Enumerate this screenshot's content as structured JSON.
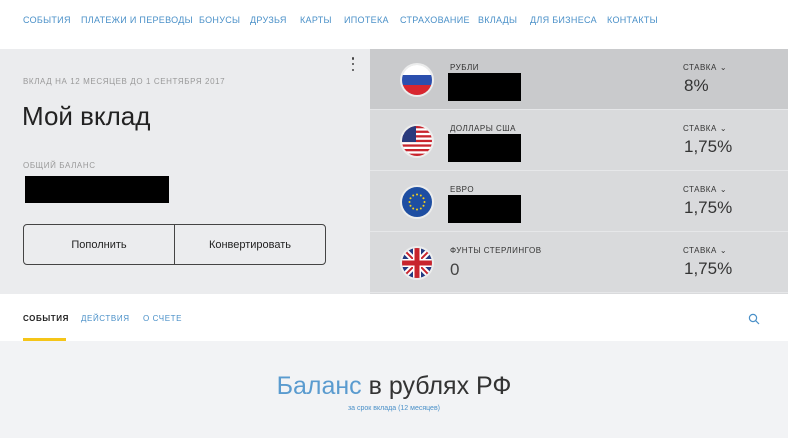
{
  "nav": {
    "items": [
      "События",
      "Платежи и переводы",
      "Бонусы",
      "Друзья",
      "Карты",
      "Ипотека",
      "Страхование",
      "Вклады",
      "Для бизнеса",
      "Контакты"
    ]
  },
  "account": {
    "subtitle": "Вклад на 12 месяцев до 1 сентября 2017",
    "title": "Мой вклад",
    "balance_label": "Общий баланс",
    "balance_value": "",
    "topup_label": "Пополнить",
    "convert_label": "Конвертировать"
  },
  "currencies": [
    {
      "name": "Рубли",
      "amount": "",
      "rate_label": "Ставка",
      "rate": "8%",
      "flag": "russia-flag-icon",
      "active": true
    },
    {
      "name": "Доллары США",
      "amount": "",
      "rate_label": "Ставка",
      "rate": "1,75%",
      "flag": "usa-flag-icon",
      "active": false
    },
    {
      "name": "Евро",
      "amount": "",
      "rate_label": "Ставка",
      "rate": "1,75%",
      "flag": "eu-flag-icon",
      "active": false
    },
    {
      "name": "Фунты стерлингов",
      "amount": "0",
      "rate_label": "Ставка",
      "rate": "1,75%",
      "flag": "uk-flag-icon",
      "active": false
    }
  ],
  "tabs": {
    "events": "События",
    "actions": "Действия",
    "about": "О счете"
  },
  "balance_section": {
    "heading_accent": "Баланс",
    "heading_rest": " в рублях РФ",
    "subtitle": "за срок вклада (12 месяцев)"
  },
  "colors": {
    "link": "#4a90c8",
    "tab_underline": "#f5c518",
    "panel_bg": "#ebecee",
    "currency_bg": "#d9dadc"
  }
}
